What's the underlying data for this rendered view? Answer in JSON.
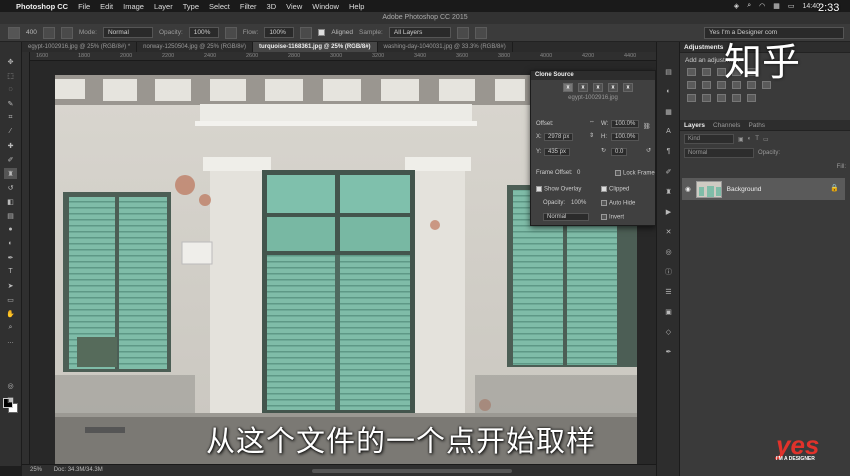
{
  "menubar": {
    "app": "Photoshop CC",
    "items": [
      "File",
      "Edit",
      "Image",
      "Layer",
      "Type",
      "Select",
      "Filter",
      "3D",
      "View",
      "Window",
      "Help"
    ],
    "time": "14:40"
  },
  "window_title": "Adobe Photoshop CC 2015",
  "options": {
    "mode_label": "Mode:",
    "mode_value": "Normal",
    "opacity_label": "Opacity:",
    "opacity_value": "100%",
    "flow_label": "Flow:",
    "flow_value": "100%",
    "aligned_label": "Aligned",
    "sample_label": "Sample:",
    "sample_value": "All Layers",
    "brush_size": "400",
    "workspace": "Yes I'm a Designer com"
  },
  "tabs": [
    {
      "label": "egypt-1002916.jpg @ 25% (RGB/8#) *",
      "active": false
    },
    {
      "label": "norway-1250504.jpg @ 25% (RGB/8#)",
      "active": false
    },
    {
      "label": "turquoise-1168361.jpg @ 25% (RGB/8#)",
      "active": true
    },
    {
      "label": "washing-day-1040031.jpg @ 33.3% (RGB/8#)",
      "active": false
    }
  ],
  "ruler_ticks": [
    "1600",
    "1800",
    "2000",
    "2200",
    "2400",
    "2600",
    "2800",
    "3000",
    "3200",
    "3400",
    "3600",
    "3800",
    "4000",
    "4200",
    "4400"
  ],
  "clone_source": {
    "title": "Clone Source",
    "source_file": "egypt-1002916.jpg",
    "offset_label": "Offset:",
    "w_label": "W:",
    "w_value": "100.0%",
    "x_label": "X:",
    "x_value": "2978 px",
    "h_label": "H:",
    "h_value": "100.0%",
    "y_label": "Y:",
    "y_value": "435 px",
    "angle_value": "0.0",
    "frame_offset_label": "Frame Offset:",
    "frame_offset_value": "0",
    "lock_frame_label": "Lock Frame",
    "show_overlay_label": "Show Overlay",
    "clipped_label": "Clipped",
    "opacity_label": "Opacity:",
    "opacity_value": "100%",
    "auto_hide_label": "Auto Hide",
    "blend_value": "Normal",
    "invert_label": "Invert"
  },
  "adjustments": {
    "tab": "Adjustments",
    "subtitle": "Add an adjustment"
  },
  "layers": {
    "tabs": [
      "Layers",
      "Channels",
      "Paths"
    ],
    "kind_placeholder": "Kind",
    "blend": "Normal",
    "opacity_label": "Opacity:",
    "fill_label": "Fill:",
    "background_layer": "Background"
  },
  "status": {
    "zoom": "25%",
    "doc": "Doc: 34.3M/34.3M"
  },
  "overlay": {
    "subtitle": "从这个文件的一个点开始取样",
    "watermark": "知乎",
    "clock": "2:33",
    "logo": "yes",
    "logo_sub": "I'M A DESIGNER"
  }
}
